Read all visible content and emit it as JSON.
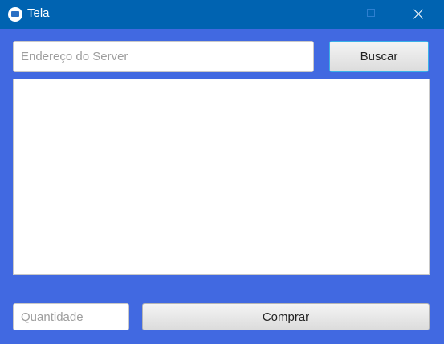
{
  "window": {
    "title": "Tela",
    "icon": "app-window-icon",
    "controls": [
      "minimize-icon",
      "maximize-icon",
      "close-icon"
    ]
  },
  "colors": {
    "titlebar": "#0063b1",
    "background": "#4169e1"
  },
  "search": {
    "server_placeholder": "Endereço do Server",
    "server_value": "",
    "button_label": "Buscar"
  },
  "results": {
    "items": []
  },
  "purchase": {
    "quantity_placeholder": "Quantidade",
    "quantity_value": "",
    "button_label": "Comprar"
  }
}
